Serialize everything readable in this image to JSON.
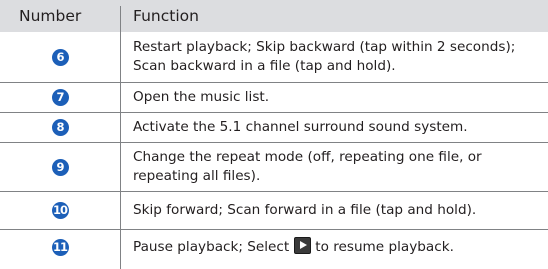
{
  "table": {
    "header": {
      "number": "Number",
      "function": "Function"
    },
    "rows": [
      {
        "number": "6",
        "function": "Restart playback; Skip backward (tap within 2 seconds); Scan backward in a file (tap and hold)."
      },
      {
        "number": "7",
        "function": "Open the music list."
      },
      {
        "number": "8",
        "function": "Activate the 5.1 channel surround sound system."
      },
      {
        "number": "9",
        "function": "Change the repeat mode (off, repeating one file, or repeating all files)."
      },
      {
        "number": "10",
        "function": "Skip forward; Scan forward in a file (tap and hold)."
      },
      {
        "number": "11",
        "function_before": "Pause playback; Select",
        "function_after": "to resume playback.",
        "icon": "play-icon"
      }
    ]
  },
  "colors": {
    "header_bg": "#dcdde0",
    "badge": "#1c5fb8",
    "rule": "#808285",
    "text": "#231f20"
  }
}
